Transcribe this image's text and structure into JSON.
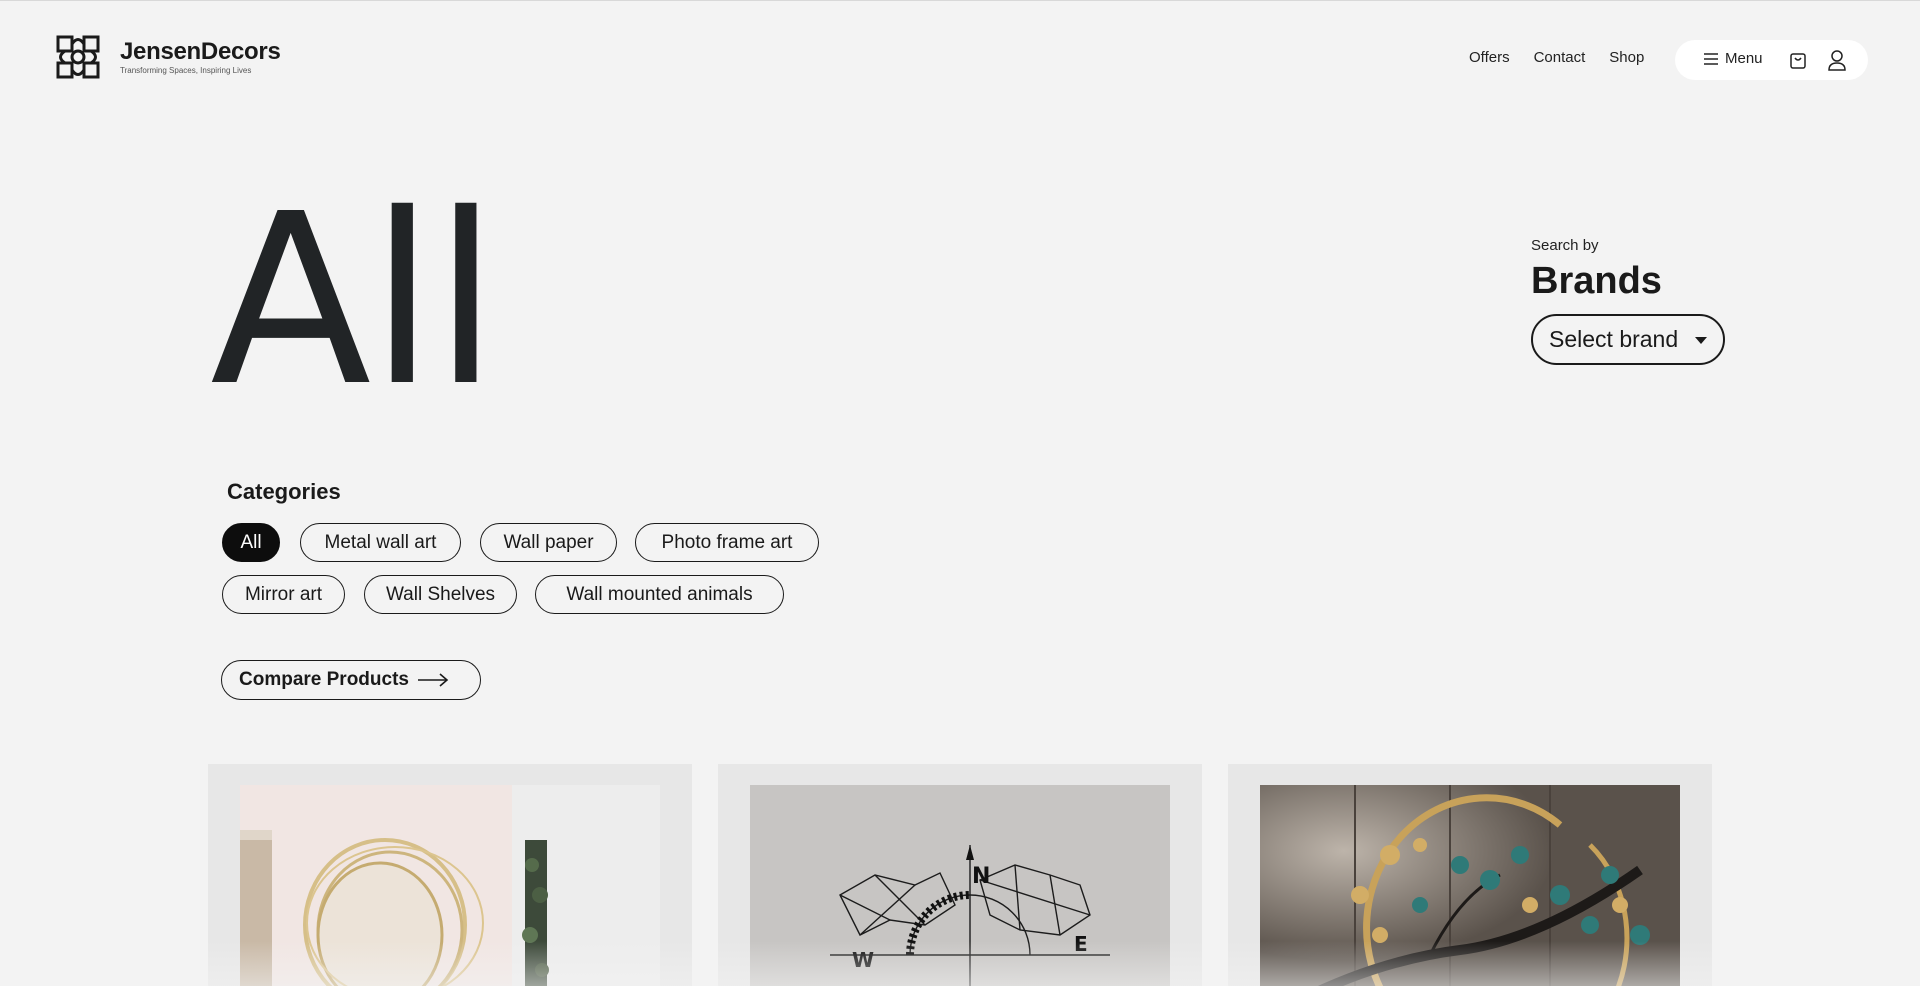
{
  "brand": {
    "name": "JensenDecors",
    "tagline": "Transforming Spaces, Inspiring Lives",
    "logo_icon": "knot-logo-icon"
  },
  "nav": {
    "links": [
      "Offers",
      "Contact",
      "Shop"
    ],
    "menu_label": "Menu",
    "menu_icon": "hamburger-icon",
    "cart_icon": "shopping-bag-icon",
    "user_icon": "user-icon"
  },
  "hero": {
    "title": "All"
  },
  "brand_search": {
    "label": "Search by",
    "title": "Brands",
    "select_value": "Select brand"
  },
  "categories": {
    "title": "Categories",
    "items": [
      {
        "label": "All",
        "active": true
      },
      {
        "label": "Metal wall art",
        "active": false
      },
      {
        "label": "Wall paper",
        "active": false
      },
      {
        "label": "Photo frame art",
        "active": false
      },
      {
        "label": "Mirror art",
        "active": false
      },
      {
        "label": "Wall Shelves",
        "active": false
      },
      {
        "label": "Wall mounted animals",
        "active": false
      }
    ]
  },
  "compare": {
    "label": "Compare Products",
    "icon": "arrow-right-icon"
  },
  "products": [
    {
      "image": "gold-ring-mirror"
    },
    {
      "image": "world-map-compass-metal-art"
    },
    {
      "image": "ginkgo-tree-metal-art"
    }
  ],
  "colors": {
    "background": "#f3f3f3",
    "text": "#1c1c1c",
    "chip_active_bg": "#0d0d0d",
    "card_bg": "#e7e7e7"
  }
}
